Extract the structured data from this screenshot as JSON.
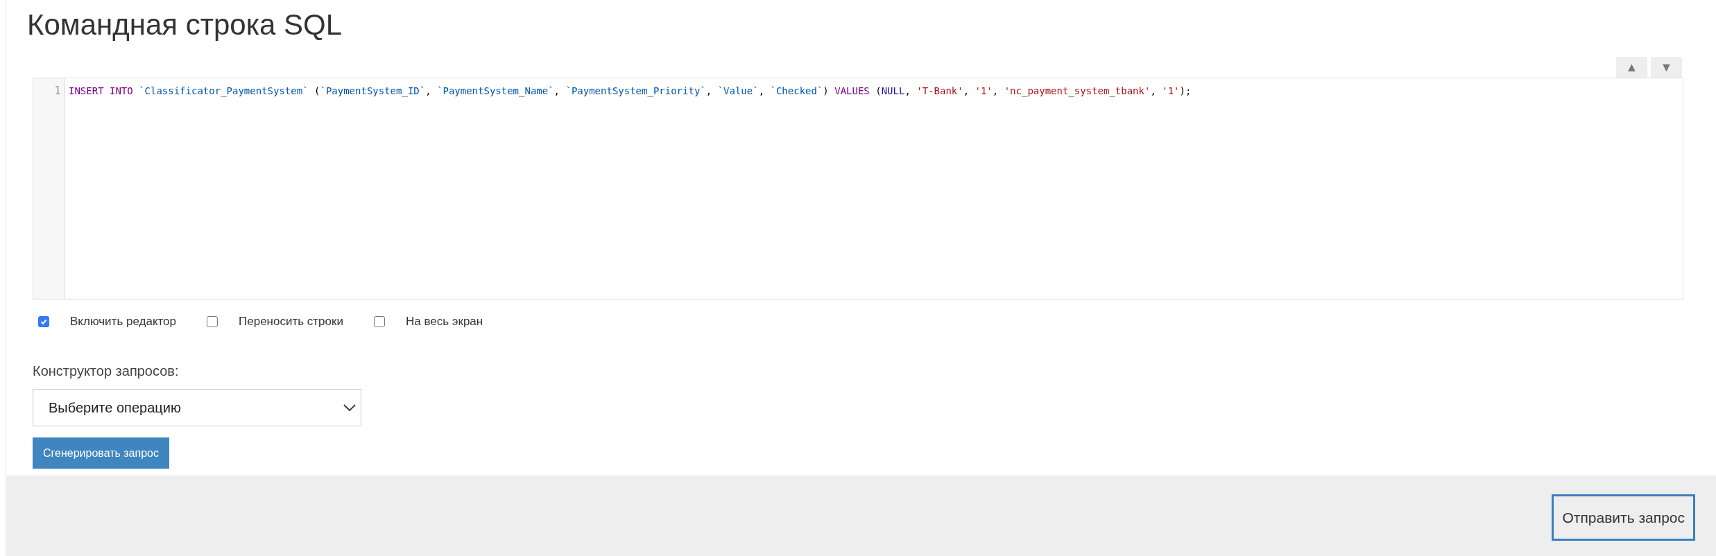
{
  "page": {
    "title": "Командная строка SQL"
  },
  "editor": {
    "scroll_buttons": [
      "▲",
      "▼"
    ],
    "lines": [
      {
        "number": "1",
        "tokens": [
          {
            "kind": "keyword",
            "text": "INSERT INTO "
          },
          {
            "kind": "identifier",
            "text": "`Classificator_PaymentSystem`"
          },
          {
            "kind": "plain",
            "text": " ("
          },
          {
            "kind": "identifier",
            "text": "`PaymentSystem_ID`"
          },
          {
            "kind": "plain",
            "text": ", "
          },
          {
            "kind": "identifier",
            "text": "`PaymentSystem_Name`"
          },
          {
            "kind": "plain",
            "text": ", "
          },
          {
            "kind": "identifier",
            "text": "`PaymentSystem_Priority`"
          },
          {
            "kind": "plain",
            "text": ", "
          },
          {
            "kind": "identifier",
            "text": "`Value`"
          },
          {
            "kind": "plain",
            "text": ", "
          },
          {
            "kind": "identifier",
            "text": "`Checked`"
          },
          {
            "kind": "plain",
            "text": ") "
          },
          {
            "kind": "keyword",
            "text": "VALUES"
          },
          {
            "kind": "plain",
            "text": " ("
          },
          {
            "kind": "atom",
            "text": "NULL"
          },
          {
            "kind": "plain",
            "text": ", "
          },
          {
            "kind": "string",
            "text": "'T-Bank'"
          },
          {
            "kind": "plain",
            "text": ", "
          },
          {
            "kind": "string",
            "text": "'1'"
          },
          {
            "kind": "plain",
            "text": ", "
          },
          {
            "kind": "string",
            "text": "'nc_payment_system_tbank'"
          },
          {
            "kind": "plain",
            "text": ", "
          },
          {
            "kind": "string",
            "text": "'1'"
          },
          {
            "kind": "plain",
            "text": ");"
          }
        ]
      }
    ]
  },
  "options": [
    {
      "label": "Включить редактор",
      "checked": true
    },
    {
      "label": "Переносить строки",
      "checked": false
    },
    {
      "label": "На весь экран",
      "checked": false
    }
  ],
  "query_builder": {
    "label": "Конструктор запросов:",
    "select_value": "Выберите операцию",
    "generate_button": "Сгенерировать запрос"
  },
  "footer": {
    "submit_button": "Отправить запрос"
  }
}
